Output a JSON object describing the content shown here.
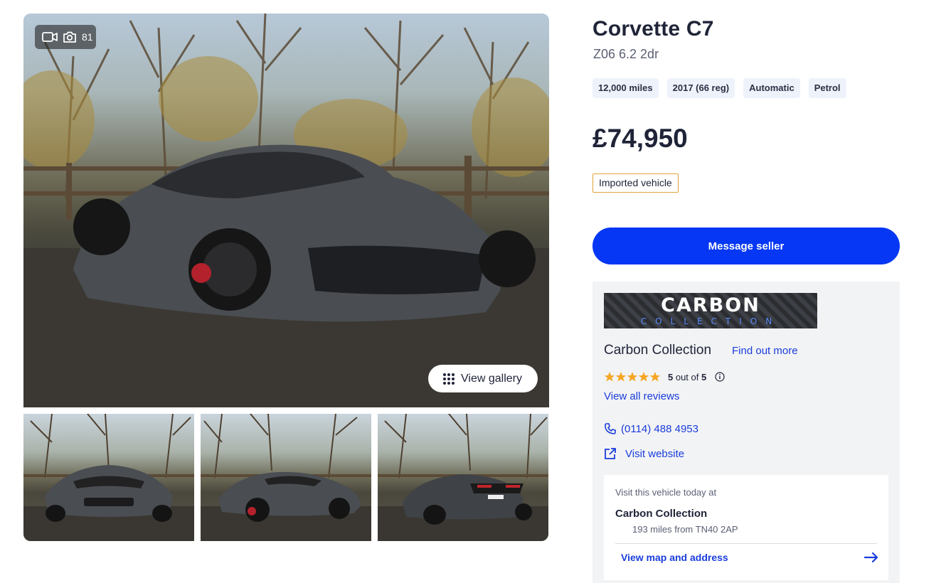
{
  "gallery": {
    "photo_count": "81",
    "view_gallery_label": "View gallery"
  },
  "listing": {
    "title": "Corvette C7",
    "subtitle": "Z06 6.2 2dr",
    "specs": [
      "12,000 miles",
      "2017 (66 reg)",
      "Automatic",
      "Petrol"
    ],
    "price": "£74,950",
    "badge": "Imported vehicle",
    "message_button": "Message seller"
  },
  "dealer": {
    "logo_main": "CARBON",
    "logo_sub": "COLLECTION",
    "name": "Carbon Collection",
    "find_out_more": "Find out more",
    "rating": {
      "value": 5,
      "max": 5,
      "score": "5",
      "out_of": " out of ",
      "max_label": "5"
    },
    "view_reviews": "View all reviews",
    "phone": "(0114) 488 4953",
    "website": "Visit website",
    "visit": {
      "label": "Visit this vehicle today at",
      "name": "Carbon Collection",
      "distance": "193 miles from TN40 2AP",
      "map_link": "View map and address"
    }
  },
  "colors": {
    "primary_button": "#0537f4",
    "link": "#1a3ddb",
    "chip_bg": "#eef2fb",
    "badge_border": "#e1a33a",
    "star": "#f5a623"
  },
  "icons": {
    "video": "video-camera-icon",
    "camera": "camera-icon",
    "grid": "grid-dots-icon",
    "phone": "phone-icon",
    "external": "external-link-icon",
    "info": "info-icon",
    "arrow": "arrow-right-icon"
  }
}
